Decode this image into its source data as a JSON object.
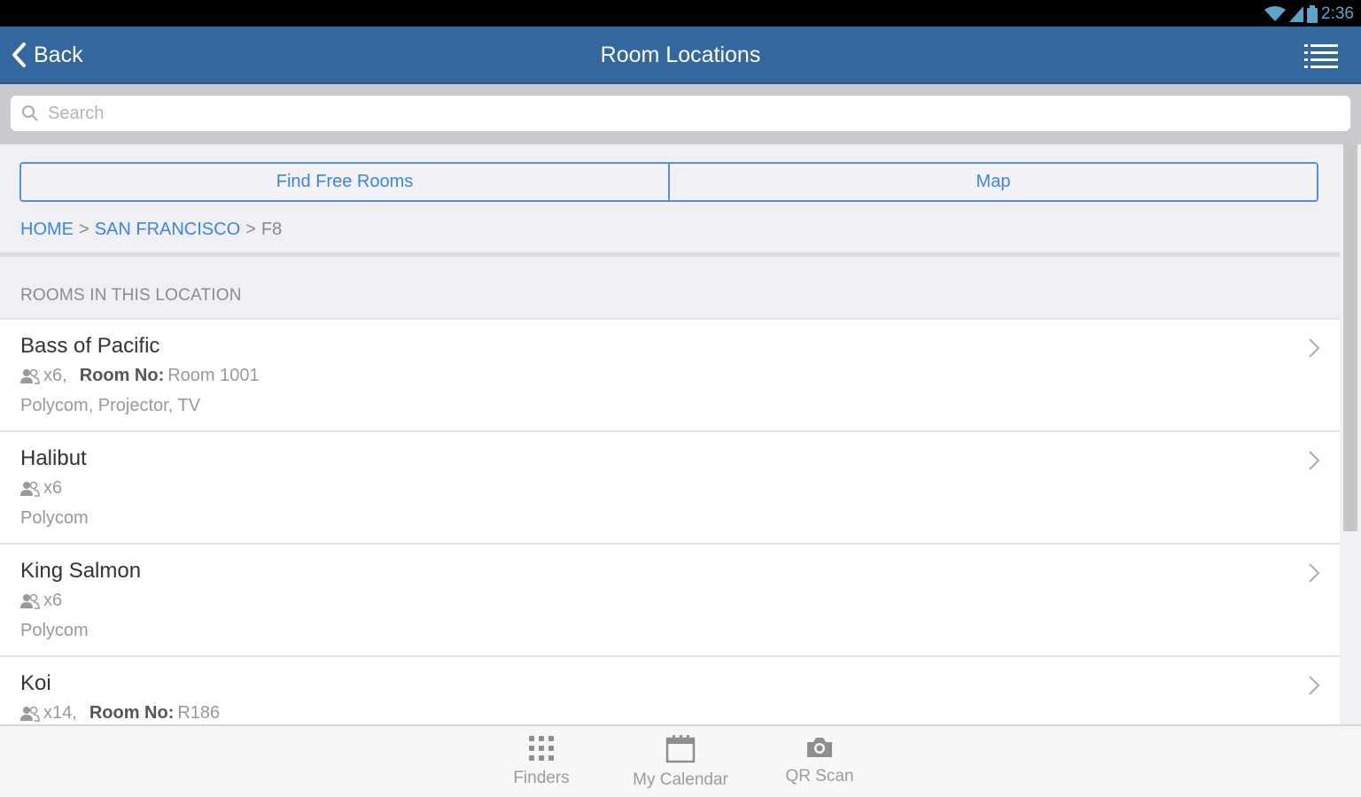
{
  "status": {
    "time": "2:36",
    "icons": [
      "wifi-icon",
      "signal-icon",
      "battery-icon"
    ]
  },
  "nav": {
    "back_label": "Back",
    "title": "Room Locations",
    "menu_icon": "menu-icon"
  },
  "search": {
    "placeholder": "Search",
    "value": ""
  },
  "segments": {
    "find_free": "Find Free Rooms",
    "map": "Map"
  },
  "breadcrumb": {
    "home": "HOME",
    "sep1": ">",
    "city": "SAN FRANCISCO",
    "sep2": ">",
    "floor": "F8"
  },
  "section": {
    "title": "ROOMS IN THIS LOCATION"
  },
  "rooms": [
    {
      "name": "Bass of Pacific",
      "capacity": "x6,",
      "room_no_label": "Room No:",
      "room_no": "Room 1001",
      "equipment": "Polycom, Projector, TV"
    },
    {
      "name": "Halibut",
      "capacity": "x6",
      "room_no_label": "",
      "room_no": "",
      "equipment": "Polycom"
    },
    {
      "name": "King Salmon",
      "capacity": "x6",
      "room_no_label": "",
      "room_no": "",
      "equipment": "Polycom"
    },
    {
      "name": "Koi",
      "capacity": "x14,",
      "room_no_label": "Room No:",
      "room_no": "R186",
      "equipment": ""
    }
  ],
  "tabs": {
    "finders": "Finders",
    "calendar": "My Calendar",
    "qr": "QR Scan"
  },
  "colors": {
    "navbar": "#33679d",
    "link": "#3d83e0",
    "segment_border": "#5b8ed9"
  }
}
